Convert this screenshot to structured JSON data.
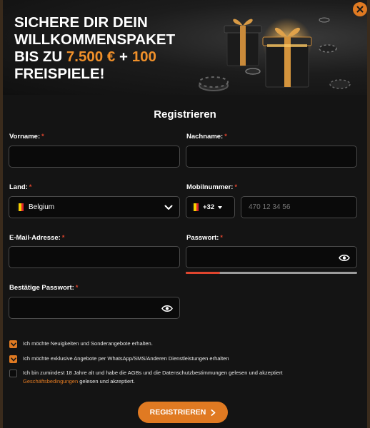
{
  "banner": {
    "line1": "SICHERE DIR DEIN",
    "line2": "WILLKOMMENSPAKET",
    "line3_prefix": "BIS ZU",
    "line3_amount": "7.500 €",
    "line3_plus": "+",
    "line3_spins": "100",
    "line4": "FREISPIELE!"
  },
  "form": {
    "title": "Registrieren",
    "required_mark": "*",
    "firstname_label": "Vorname:",
    "firstname_value": "",
    "lastname_label": "Nachname:",
    "lastname_value": "",
    "country_label": "Land:",
    "country_value": "Belgium",
    "mobile_label": "Mobilnummer:",
    "dial_code": "+32",
    "phone_placeholder": "470 12 34 56",
    "email_label": "E-Mail-Adresse:",
    "email_value": "",
    "password_label": "Passwort:",
    "password_value": "",
    "password_strength": 0.2,
    "confirm_label": "Bestätige Passwort:",
    "confirm_value": ""
  },
  "consents": [
    {
      "text": "Ich möchte Neuigkeiten und Sonderangebote erhalten.",
      "checked": true
    },
    {
      "text": "Ich möchte exklusive Angebote per WhatsApp/SMS/Anderen Dienstleistungen erhalten",
      "checked": true
    },
    {
      "text": "Ich bin zumindest 18 Jahre alt und habe die AGBs und die Datenschutzbestimmungen gelesen und akzeptiert",
      "link": "Geschäftsbedingungen",
      "text_after": " gelesen und akzeptiert.",
      "checked": false
    }
  ],
  "submit_label": "REGISTRIEREN",
  "colors": {
    "accent": "#e07a22",
    "banner_highlight": "#f0902a",
    "required": "#e0452e",
    "flag_black": "#111111",
    "flag_yellow": "#f5d000",
    "flag_red": "#e0252e"
  },
  "icons": [
    "close-icon",
    "chevron-down-icon",
    "caret-down-icon",
    "eye-icon",
    "check-icon",
    "chevron-right-icon"
  ]
}
